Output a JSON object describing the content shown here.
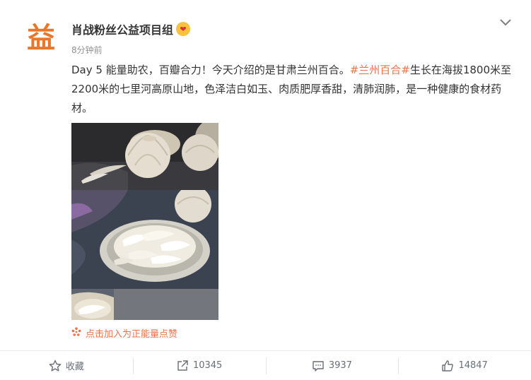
{
  "post": {
    "avatar_char": "益",
    "username": "肖战粉丝公益项目组",
    "badge_char": "❤",
    "timestamp": "8分钟前",
    "text_before": "Day 5  能量助农，百瓣合力！今天介绍的是甘肃兰州百合。",
    "hashtag": "#兰州百合#",
    "text_after": "生长在海拔1800米至2200米的七里河高原山地，色泽洁白如玉、肉质肥厚香甜，清肺润肺，是一种健康的食材药材。",
    "energy_label": "点击加入为正能量点赞"
  },
  "actions": {
    "favorite_label": "收藏",
    "share_count": "10345",
    "comment_count": "3937",
    "like_count": "14847"
  },
  "colors": {
    "accent": "#eb7350",
    "avatar": "#e8762b",
    "muted": "#939393"
  }
}
